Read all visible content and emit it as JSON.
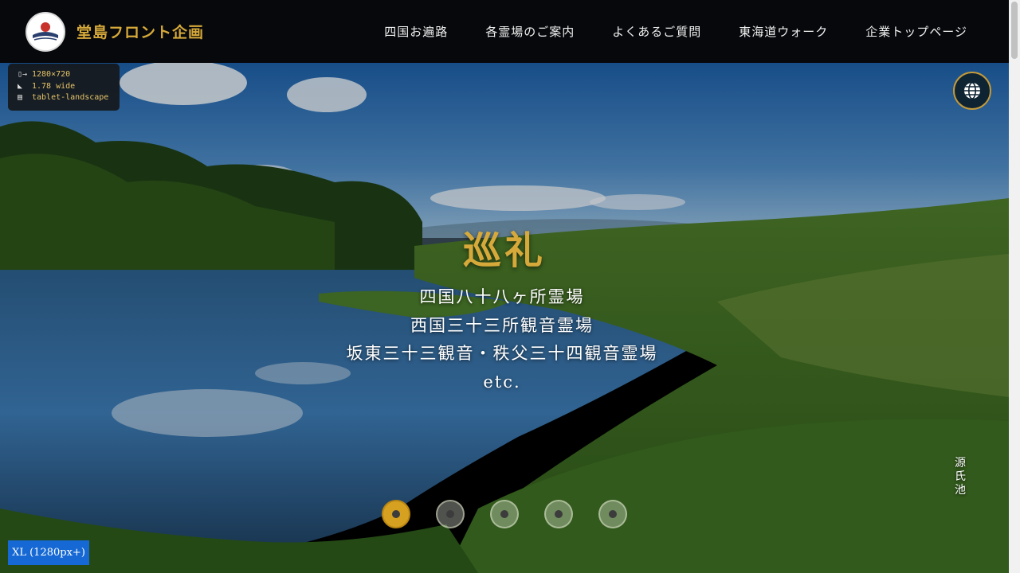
{
  "header": {
    "brand": "堂島フロント企画",
    "nav": [
      "四国お遍路",
      "各霊場のご案内",
      "よくあるご質問",
      "東海道ウォーク",
      "企業トップページ"
    ]
  },
  "hero": {
    "title": "巡礼",
    "lines": [
      "四国八十八ヶ所霊場",
      "西国三十三所観音霊場",
      "坂東三十三観音・秩父三十四観音霊場",
      "etc."
    ],
    "caption": "源氏池",
    "slides_total": 5,
    "active_slide": 1
  },
  "device_info": {
    "resolution": "1280×720",
    "ratio": "1.78 wide",
    "mode": "tablet-landscape"
  },
  "breakpoint_label": "XL (1280px+)",
  "colors": {
    "accent_gold": "#d6a93a",
    "header_bg": "#06080b",
    "breakpoint_blue": "#1669d4"
  },
  "icons": {
    "globe_button": "globe-icon"
  }
}
